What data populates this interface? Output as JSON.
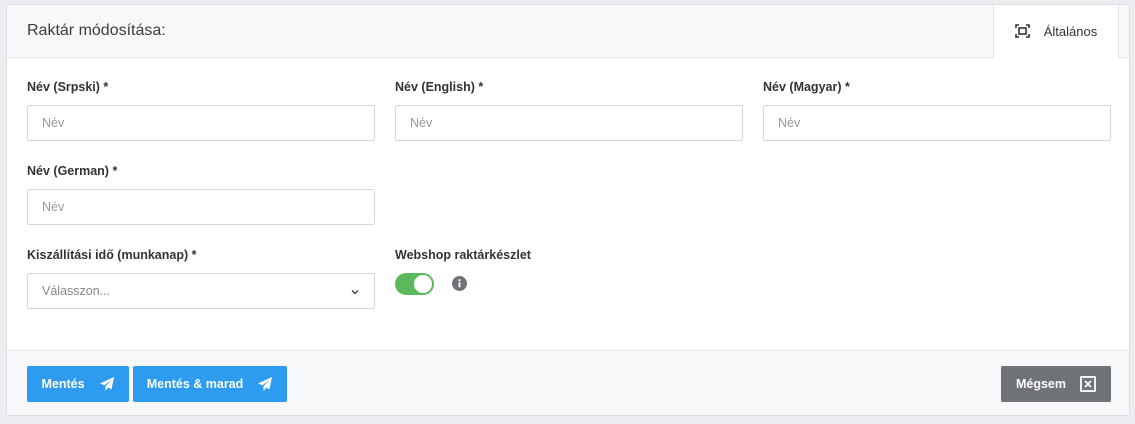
{
  "header": {
    "title": "Raktár módosítása:",
    "tab_label": "Általános",
    "tab_icon": "expand-icon"
  },
  "fields": {
    "name_sr": {
      "label": "Név (Srpski) *",
      "placeholder": "Név"
    },
    "name_en": {
      "label": "Név (English) *",
      "placeholder": "Név"
    },
    "name_hu": {
      "label": "Név (Magyar) *",
      "placeholder": "Név"
    },
    "name_de": {
      "label": "Név (German) *",
      "placeholder": "Név"
    },
    "delivery": {
      "label": "Kiszállítási idő (munkanap) *",
      "placeholder": "Válasszon..."
    },
    "webshop": {
      "label": "Webshop raktárkészlet",
      "enabled": true
    }
  },
  "footer": {
    "save_label": "Mentés",
    "save_stay_label": "Mentés & marad",
    "cancel_label": "Mégsem"
  },
  "colors": {
    "primary": "#2d9cf0",
    "toggle_on": "#5cb85c",
    "cancel": "#6f7378"
  }
}
